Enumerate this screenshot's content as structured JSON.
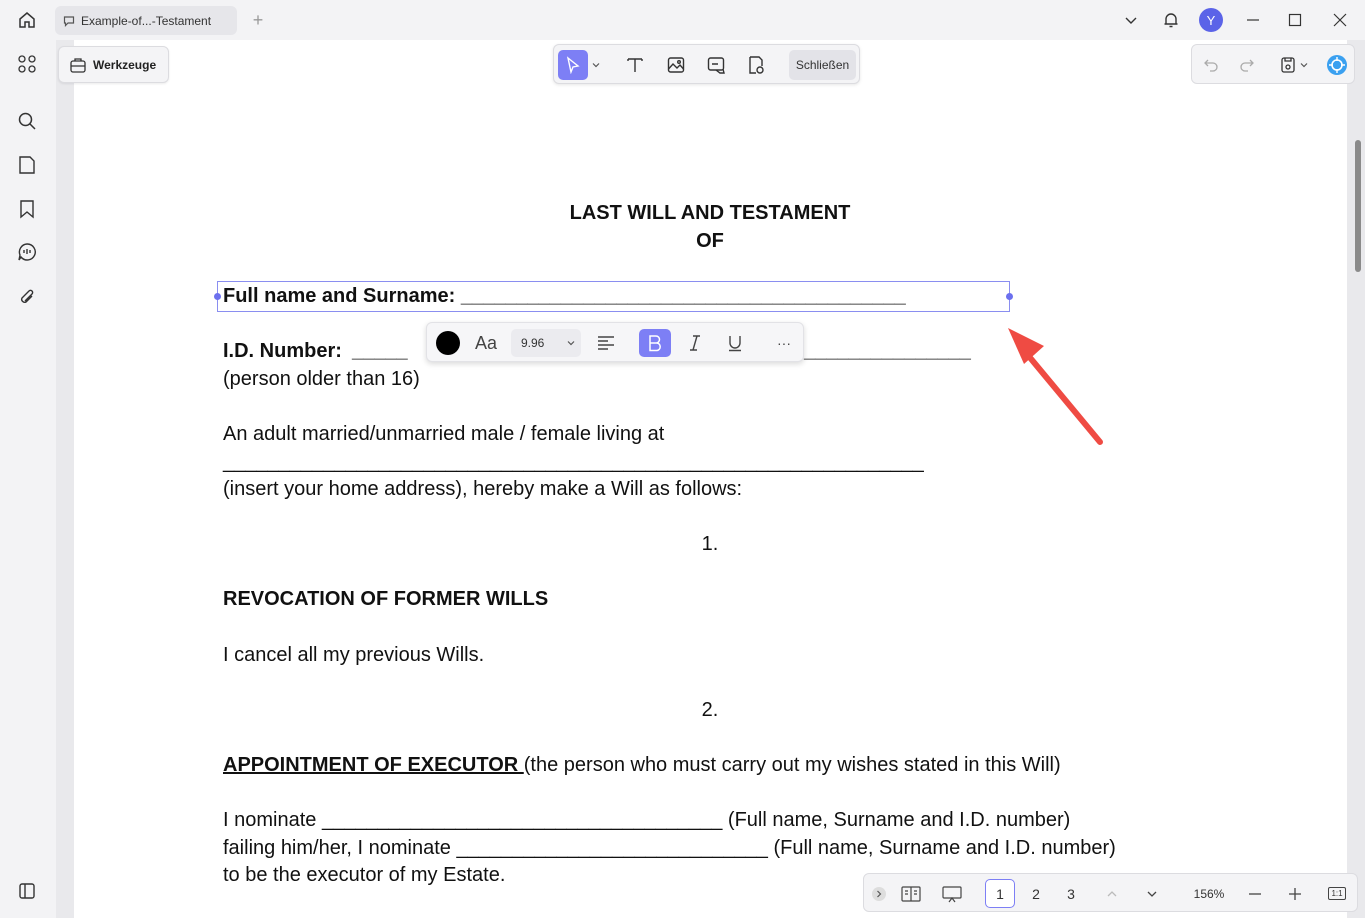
{
  "titlebar": {
    "tab_title": "Example-of...-Testament",
    "avatar_letter": "Y"
  },
  "toolbar": {
    "tools_label": "Werkzeuge",
    "close_label": "Schließen"
  },
  "format_bar": {
    "font_size": "9.96",
    "font_label": "Aa",
    "color": "#000000"
  },
  "document": {
    "title_line1": "LAST WILL AND TESTAMENT",
    "title_line2": "OF",
    "full_name_label": "Full name and Surname: ________________________________________",
    "id_label": "I.D. Number:",
    "id_blank_left": "_____",
    "id_blank_right": "_______________",
    "person_older": "(person older than 16)",
    "adult_line": "An adult married/unmarried male / female living at",
    "address_blank": "_______________________________________________________________",
    "insert_address": "(insert your home address), hereby make a Will as follows:",
    "num1": "1.",
    "revocation_heading": "REVOCATION OF FORMER WILLS",
    "revocation_text": "I cancel all my previous Wills.",
    "num2": "2.",
    "executor_heading": "APPOINTMENT OF EXECUTOR ",
    "executor_note": "(the person who must carry out my wishes stated in this Will)",
    "nominate1": "I nominate ____________________________________ (Full name, Surname and I.D. number)",
    "nominate2": "failing   him/her, I nominate ____________________________ (Full name, Surname and I.D. number)",
    "executor_of_estate": "to be the executor of my Estate."
  },
  "bottom_bar": {
    "pages": [
      "1",
      "2",
      "3"
    ],
    "current_page": "1",
    "zoom": "156%",
    "fit_label": "1:1"
  },
  "colors": {
    "accent": "#7d7ff5",
    "arrow": "#ef4b43",
    "avatar": "#5b63e8"
  }
}
